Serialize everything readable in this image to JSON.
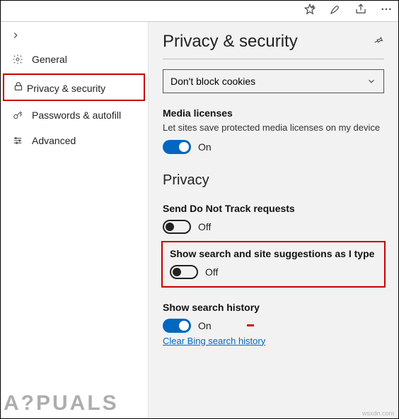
{
  "topbar": {},
  "sidebar": {
    "items": [
      {
        "label": "General"
      },
      {
        "label": "Privacy & security"
      },
      {
        "label": "Passwords & autofill"
      },
      {
        "label": "Advanced"
      }
    ]
  },
  "main": {
    "title": "Privacy & security",
    "cookies_dropdown": "Don't block cookies",
    "media_licenses_head": "Media licenses",
    "media_licenses_desc": "Let sites save protected media licenses on my device",
    "media_licenses_state": "On",
    "privacy_head": "Privacy",
    "dnt_head": "Send Do Not Track requests",
    "dnt_state": "Off",
    "suggest_head": "Show search and site suggestions as I type",
    "suggest_state": "Off",
    "history_head": "Show search history",
    "history_state": "On",
    "clear_link": "Clear Bing search history"
  },
  "watermark": "A?PUALS",
  "watermark2": "wsxdn.com"
}
